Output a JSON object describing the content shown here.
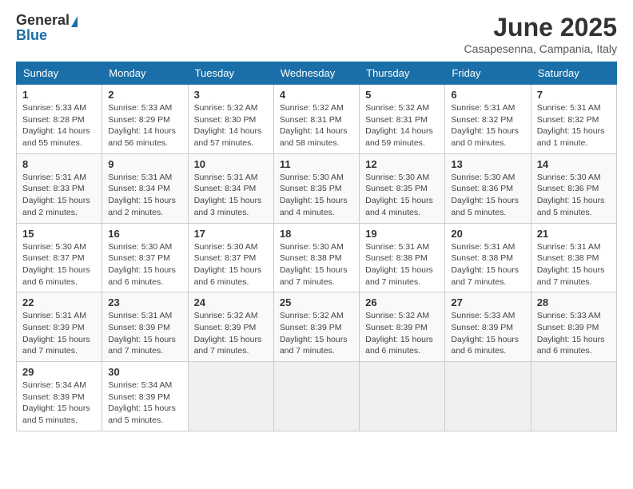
{
  "header": {
    "logo_general": "General",
    "logo_blue": "Blue",
    "month_title": "June 2025",
    "location": "Casapesenna, Campania, Italy"
  },
  "weekdays": [
    "Sunday",
    "Monday",
    "Tuesday",
    "Wednesday",
    "Thursday",
    "Friday",
    "Saturday"
  ],
  "weeks": [
    [
      {
        "day": "1",
        "sunrise": "5:33 AM",
        "sunset": "8:28 PM",
        "daylight": "14 hours and 55 minutes."
      },
      {
        "day": "2",
        "sunrise": "5:33 AM",
        "sunset": "8:29 PM",
        "daylight": "14 hours and 56 minutes."
      },
      {
        "day": "3",
        "sunrise": "5:32 AM",
        "sunset": "8:30 PM",
        "daylight": "14 hours and 57 minutes."
      },
      {
        "day": "4",
        "sunrise": "5:32 AM",
        "sunset": "8:31 PM",
        "daylight": "14 hours and 58 minutes."
      },
      {
        "day": "5",
        "sunrise": "5:32 AM",
        "sunset": "8:31 PM",
        "daylight": "14 hours and 59 minutes."
      },
      {
        "day": "6",
        "sunrise": "5:31 AM",
        "sunset": "8:32 PM",
        "daylight": "15 hours and 0 minutes."
      },
      {
        "day": "7",
        "sunrise": "5:31 AM",
        "sunset": "8:32 PM",
        "daylight": "15 hours and 1 minute."
      }
    ],
    [
      {
        "day": "8",
        "sunrise": "5:31 AM",
        "sunset": "8:33 PM",
        "daylight": "15 hours and 2 minutes."
      },
      {
        "day": "9",
        "sunrise": "5:31 AM",
        "sunset": "8:34 PM",
        "daylight": "15 hours and 2 minutes."
      },
      {
        "day": "10",
        "sunrise": "5:31 AM",
        "sunset": "8:34 PM",
        "daylight": "15 hours and 3 minutes."
      },
      {
        "day": "11",
        "sunrise": "5:30 AM",
        "sunset": "8:35 PM",
        "daylight": "15 hours and 4 minutes."
      },
      {
        "day": "12",
        "sunrise": "5:30 AM",
        "sunset": "8:35 PM",
        "daylight": "15 hours and 4 minutes."
      },
      {
        "day": "13",
        "sunrise": "5:30 AM",
        "sunset": "8:36 PM",
        "daylight": "15 hours and 5 minutes."
      },
      {
        "day": "14",
        "sunrise": "5:30 AM",
        "sunset": "8:36 PM",
        "daylight": "15 hours and 5 minutes."
      }
    ],
    [
      {
        "day": "15",
        "sunrise": "5:30 AM",
        "sunset": "8:37 PM",
        "daylight": "15 hours and 6 minutes."
      },
      {
        "day": "16",
        "sunrise": "5:30 AM",
        "sunset": "8:37 PM",
        "daylight": "15 hours and 6 minutes."
      },
      {
        "day": "17",
        "sunrise": "5:30 AM",
        "sunset": "8:37 PM",
        "daylight": "15 hours and 6 minutes."
      },
      {
        "day": "18",
        "sunrise": "5:30 AM",
        "sunset": "8:38 PM",
        "daylight": "15 hours and 7 minutes."
      },
      {
        "day": "19",
        "sunrise": "5:31 AM",
        "sunset": "8:38 PM",
        "daylight": "15 hours and 7 minutes."
      },
      {
        "day": "20",
        "sunrise": "5:31 AM",
        "sunset": "8:38 PM",
        "daylight": "15 hours and 7 minutes."
      },
      {
        "day": "21",
        "sunrise": "5:31 AM",
        "sunset": "8:38 PM",
        "daylight": "15 hours and 7 minutes."
      }
    ],
    [
      {
        "day": "22",
        "sunrise": "5:31 AM",
        "sunset": "8:39 PM",
        "daylight": "15 hours and 7 minutes."
      },
      {
        "day": "23",
        "sunrise": "5:31 AM",
        "sunset": "8:39 PM",
        "daylight": "15 hours and 7 minutes."
      },
      {
        "day": "24",
        "sunrise": "5:32 AM",
        "sunset": "8:39 PM",
        "daylight": "15 hours and 7 minutes."
      },
      {
        "day": "25",
        "sunrise": "5:32 AM",
        "sunset": "8:39 PM",
        "daylight": "15 hours and 7 minutes."
      },
      {
        "day": "26",
        "sunrise": "5:32 AM",
        "sunset": "8:39 PM",
        "daylight": "15 hours and 6 minutes."
      },
      {
        "day": "27",
        "sunrise": "5:33 AM",
        "sunset": "8:39 PM",
        "daylight": "15 hours and 6 minutes."
      },
      {
        "day": "28",
        "sunrise": "5:33 AM",
        "sunset": "8:39 PM",
        "daylight": "15 hours and 6 minutes."
      }
    ],
    [
      {
        "day": "29",
        "sunrise": "5:34 AM",
        "sunset": "8:39 PM",
        "daylight": "15 hours and 5 minutes."
      },
      {
        "day": "30",
        "sunrise": "5:34 AM",
        "sunset": "8:39 PM",
        "daylight": "15 hours and 5 minutes."
      },
      null,
      null,
      null,
      null,
      null
    ]
  ]
}
